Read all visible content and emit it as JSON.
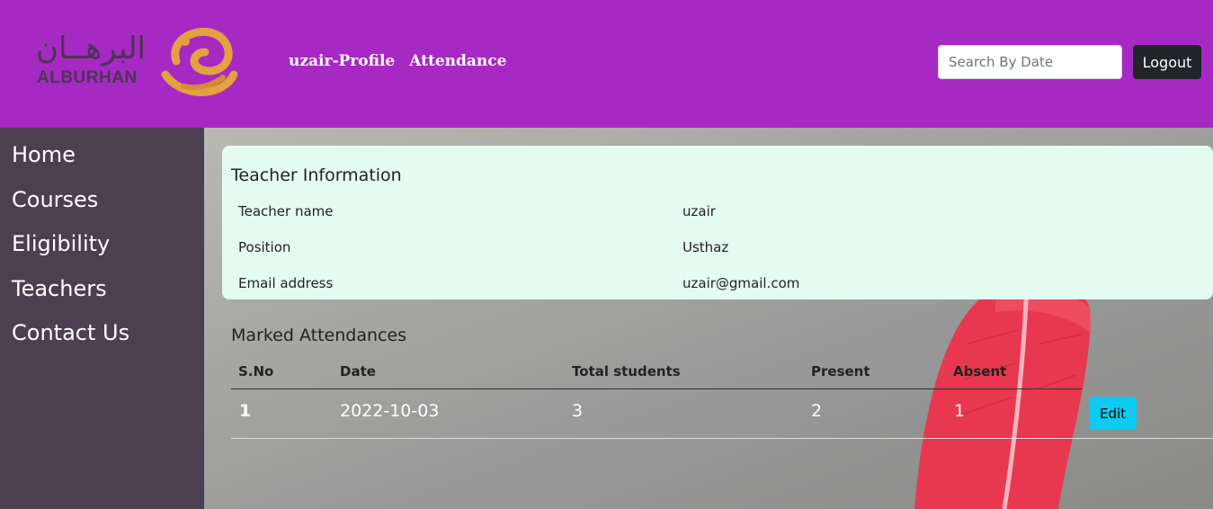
{
  "header": {
    "logo_arabic": "البرهــان",
    "logo_english": "ALBURHAN",
    "nav": [
      "uzair-Profile",
      "Attendance"
    ],
    "search_placeholder": "Search By Date",
    "logout_label": "Logout"
  },
  "sidebar": {
    "items": [
      "Home",
      "Courses",
      "Eligibility",
      "Teachers",
      "Contact Us"
    ]
  },
  "teacher_info": {
    "title": "Teacher Information",
    "rows": [
      {
        "label": "Teacher name",
        "value": "uzair"
      },
      {
        "label": "Position",
        "value": "Usthaz"
      },
      {
        "label": "Email address",
        "value": "uzair@gmail.com"
      }
    ]
  },
  "attendance": {
    "title": "Marked Attendances",
    "columns": [
      "S.No",
      "Date",
      "Total students",
      "Present",
      "Absent"
    ],
    "rows": [
      {
        "sno": "1",
        "date": "2022-10-03",
        "total": "3",
        "present": "2",
        "absent": "1",
        "action": "Edit"
      }
    ]
  },
  "colors": {
    "header": "#a729c4",
    "sidebar": "#4b3f50",
    "card": "#e4fbf2",
    "edit_button": "#0dcaf0",
    "logout_button": "#212529"
  }
}
